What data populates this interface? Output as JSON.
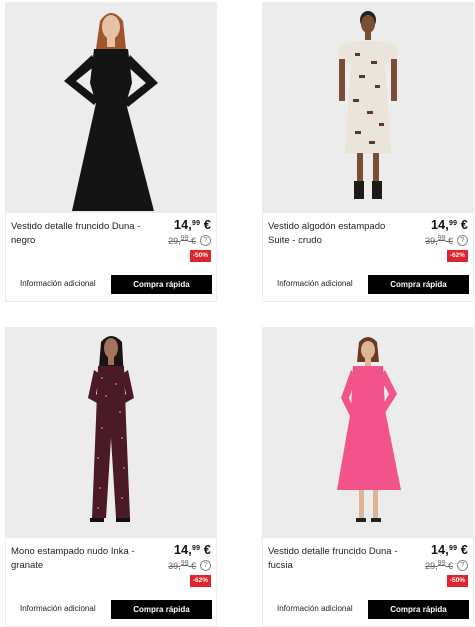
{
  "products": [
    {
      "name": "Vestido detalle fruncido Duna - negro",
      "price_int": "14,",
      "price_dec": "99",
      "price_cur": " €",
      "old_int": "29,",
      "old_dec": "99",
      "old_cur": " €",
      "discount": "-50%",
      "info_label": "Información adicional",
      "buy_label": "Compra rápida",
      "garment_color": "#141414"
    },
    {
      "name": "Vestido algodón estampado Suite - crudo",
      "price_int": "14,",
      "price_dec": "99",
      "price_cur": " €",
      "old_int": "39,",
      "old_dec": "99",
      "old_cur": " €",
      "discount": "-62%",
      "info_label": "Información adicional",
      "buy_label": "Compra rápida",
      "garment_color": "#ebe4da"
    },
    {
      "name": "Mono estampado nudo Inka - granate",
      "price_int": "14,",
      "price_dec": "99",
      "price_cur": " €",
      "old_int": "39,",
      "old_dec": "99",
      "old_cur": " €",
      "discount": "-62%",
      "info_label": "Información adicional",
      "buy_label": "Compra rápida",
      "garment_color": "#4a1a26"
    },
    {
      "name": "Vestido detalle fruncido Duna - fucsia",
      "price_int": "14,",
      "price_dec": "99",
      "price_cur": " €",
      "old_int": "29,",
      "old_dec": "99",
      "old_cur": " €",
      "discount": "-50%",
      "info_label": "Información adicional",
      "buy_label": "Compra rápida",
      "garment_color": "#f2538a"
    }
  ],
  "colors": {
    "badge": "#e0242e",
    "button": "#000000",
    "photo_bg": "#ececec"
  }
}
